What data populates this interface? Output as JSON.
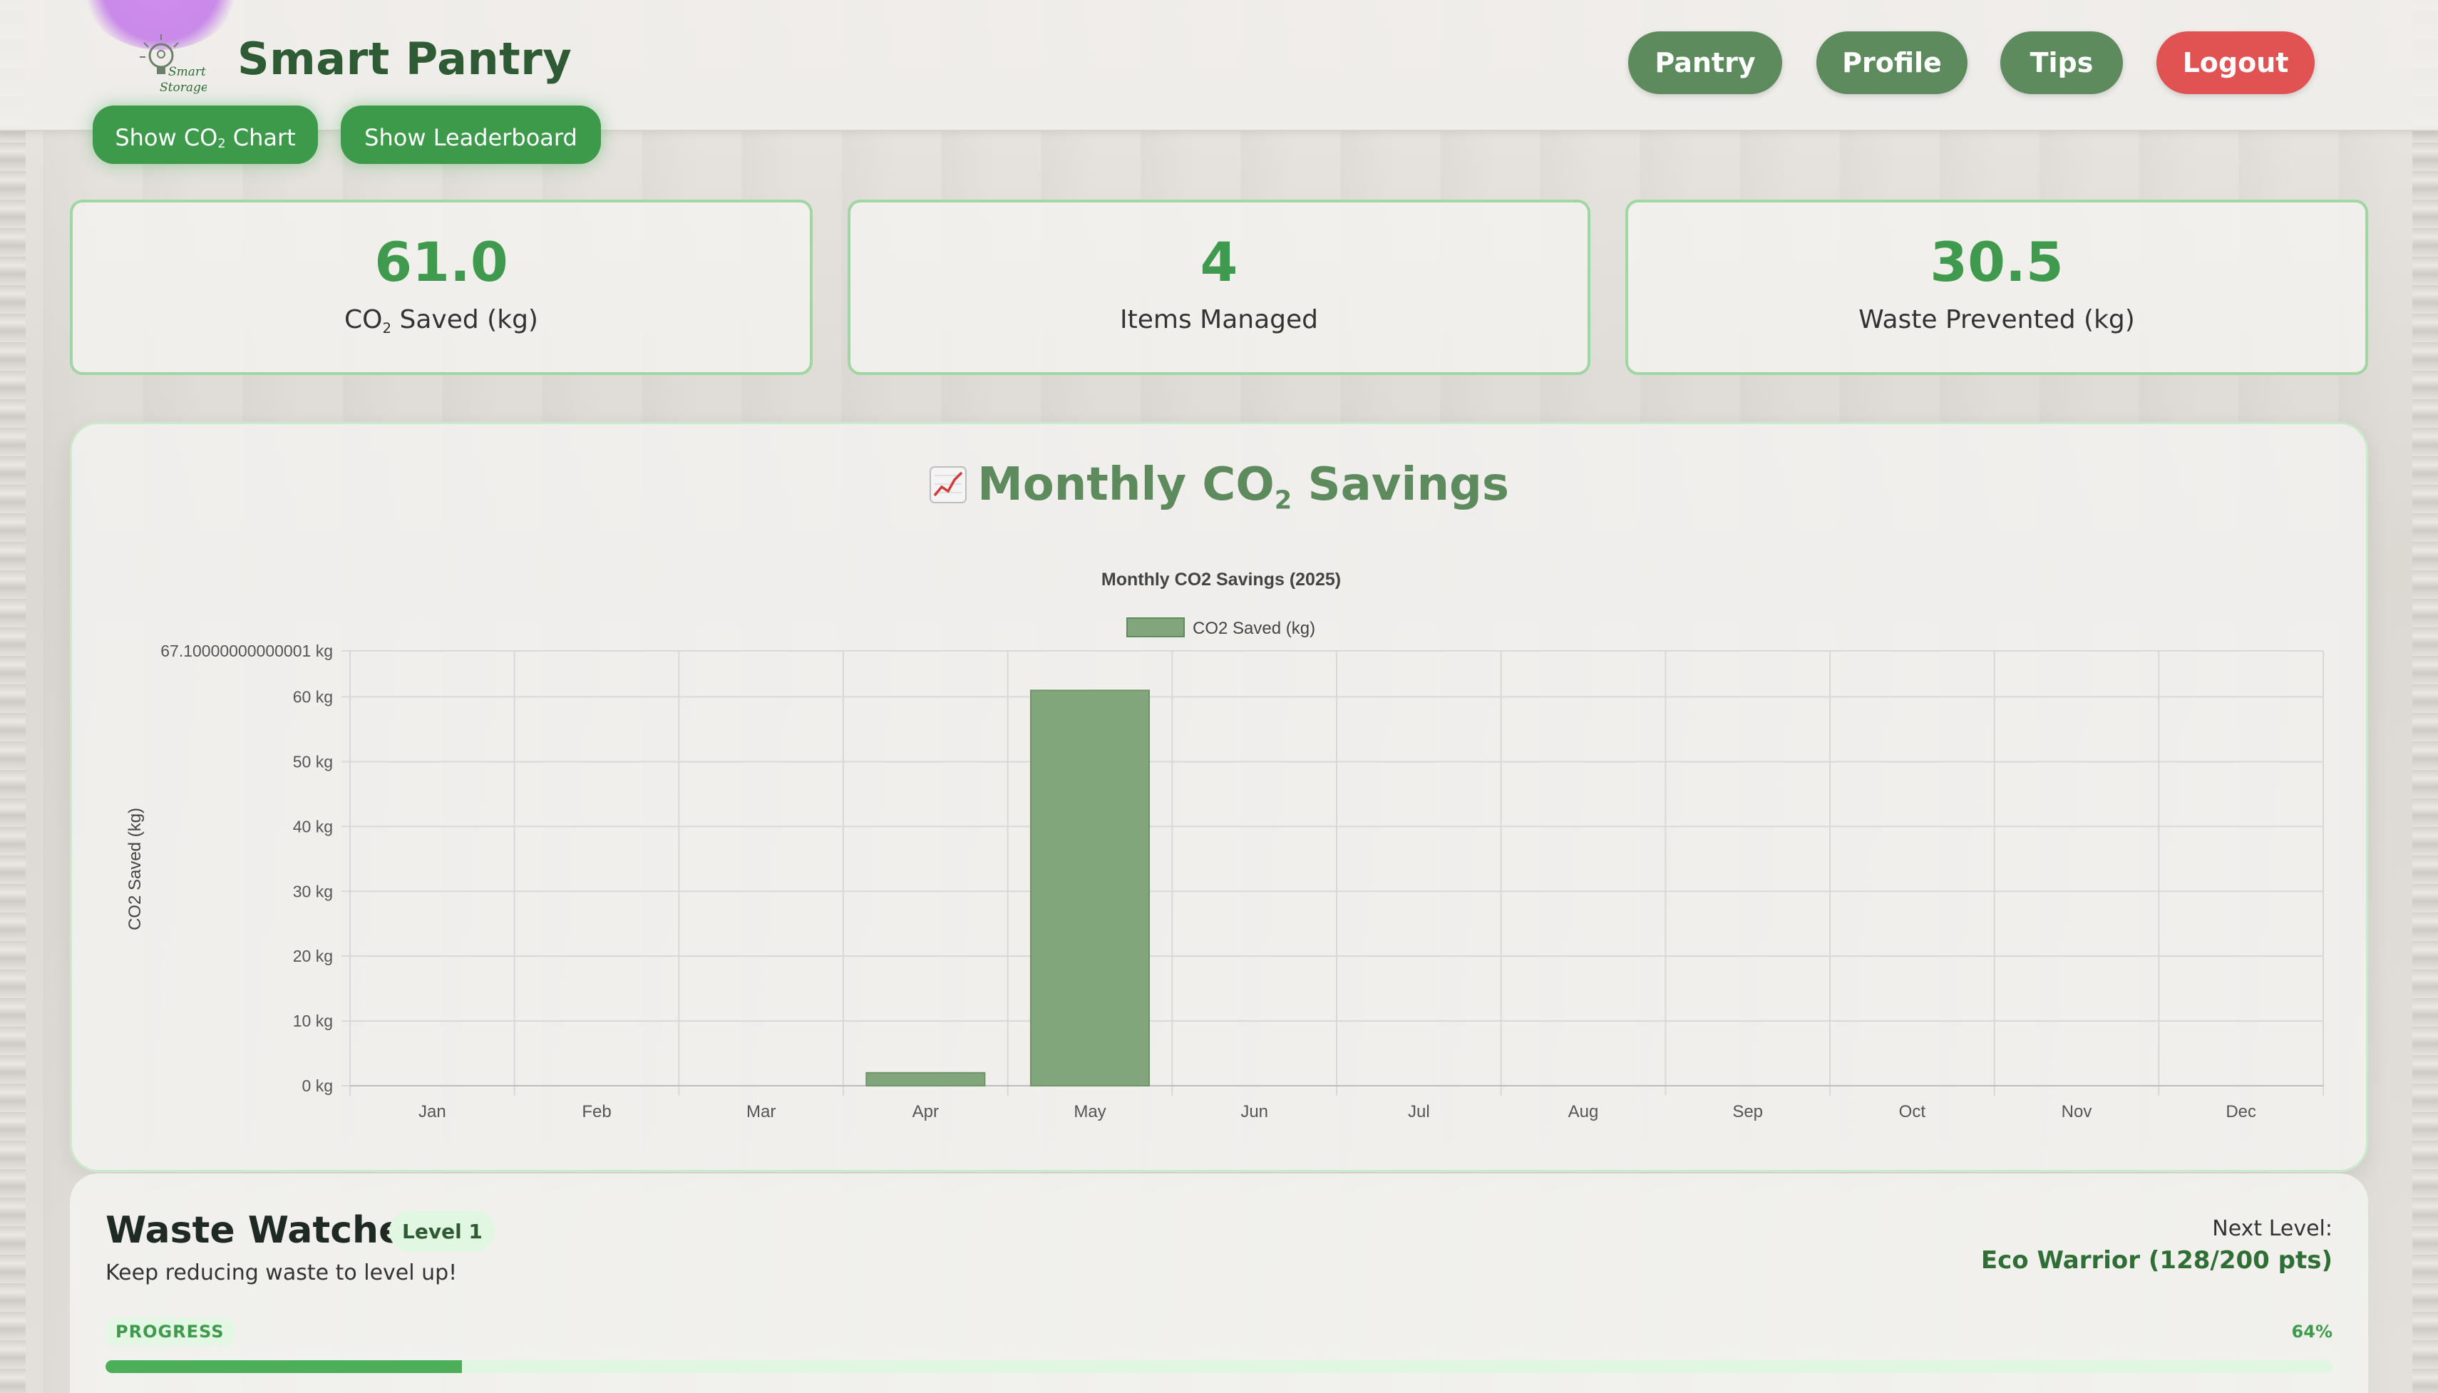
{
  "app": {
    "title": "Smart Pantry",
    "logo_text_1": "Smart",
    "logo_text_2": "Storage"
  },
  "nav": {
    "pantry": "Pantry",
    "profile": "Profile",
    "tips": "Tips",
    "logout": "Logout"
  },
  "actions": {
    "co2_chart_pre": "Show CO",
    "co2_chart_sub": "2",
    "co2_chart_post": " Chart",
    "leaderboard": "Show Leaderboard"
  },
  "stats": [
    {
      "value": "61.0",
      "label_pre": "CO",
      "label_sub": "2",
      "label_post": " Saved (kg)"
    },
    {
      "value": "4",
      "label": "Items Managed"
    },
    {
      "value": "30.5",
      "label": "Waste Prevented (kg)"
    }
  ],
  "chart_section": {
    "heading_pre": "Monthly CO",
    "heading_sub": "2",
    "heading_post": " Savings",
    "icon": "chart-increasing-icon"
  },
  "chart_data": {
    "type": "bar",
    "title": "Monthly CO2 Savings (2025)",
    "ylabel": "CO2 Saved (kg)",
    "xlabel": "",
    "legend": "CO2 Saved (kg)",
    "legend_position": "top-center",
    "categories": [
      "Jan",
      "Feb",
      "Mar",
      "Apr",
      "May",
      "Jun",
      "Jul",
      "Aug",
      "Sep",
      "Oct",
      "Nov",
      "Dec"
    ],
    "series": [
      {
        "name": "CO2 Saved (kg)",
        "values": [
          0,
          0,
          0,
          2.0,
          61.0,
          0,
          0,
          0,
          0,
          0,
          0,
          0
        ]
      }
    ],
    "ylim": [
      0,
      67.10000000000001
    ],
    "yticks": [
      "0 kg",
      "10 kg",
      "20 kg",
      "30 kg",
      "40 kg",
      "50 kg",
      "60 kg",
      "67.10000000000001 kg"
    ],
    "ytick_values": [
      0,
      10,
      20,
      30,
      40,
      50,
      60,
      67.10000000000001
    ],
    "grid": true,
    "color": "#5e8b5e"
  },
  "level": {
    "title": "Waste Watcher",
    "badge": "Level 1",
    "subtitle": "Keep reducing waste to level up!",
    "next_label": "Next Level:",
    "next_value": "Eco Warrior (128/200 pts)",
    "progress_label": "PROGRESS",
    "progress_text": "64%",
    "progress_fraction": 0.16
  },
  "colors": {
    "brand_green": "#2f5b34",
    "button_green": "#5e8b5e",
    "accent_green": "#3f9a4d",
    "logout_red": "#e15252"
  }
}
